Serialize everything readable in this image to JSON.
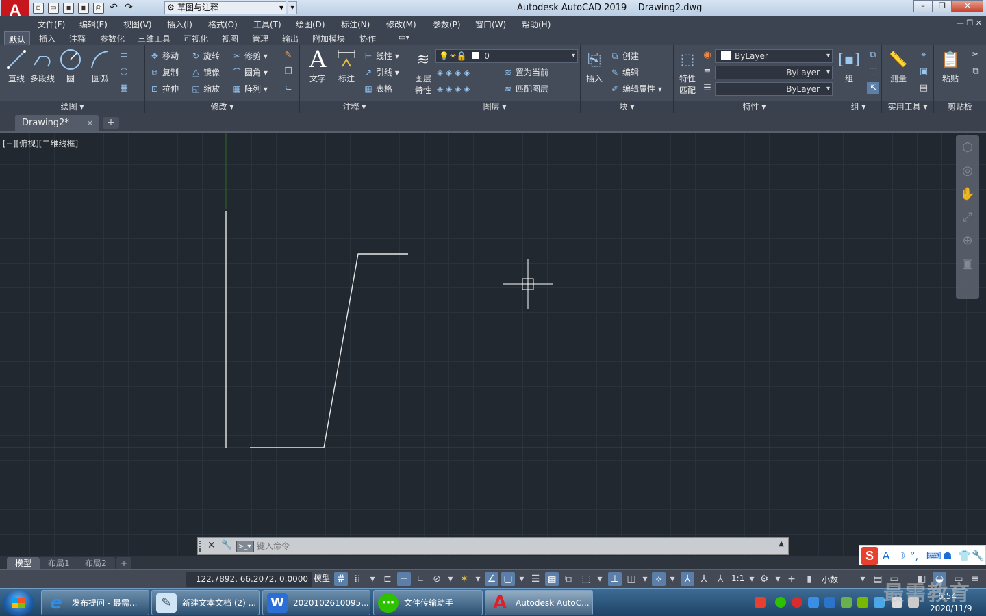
{
  "title_bar": {
    "logo_letter": "A",
    "workspace": "草图与注释",
    "app_title": "Autodesk AutoCAD 2019    Drawing2.dwg"
  },
  "menu": [
    "文件(F)",
    "编辑(E)",
    "视图(V)",
    "插入(I)",
    "格式(O)",
    "工具(T)",
    "绘图(D)",
    "标注(N)",
    "修改(M)",
    "参数(P)",
    "窗口(W)",
    "帮助(H)"
  ],
  "ribbon_tabs": [
    "默认",
    "插入",
    "注释",
    "参数化",
    "三维工具",
    "可视化",
    "视图",
    "管理",
    "输出",
    "附加模块",
    "协作"
  ],
  "ribbon": {
    "draw": {
      "title": "绘图",
      "line": "直线",
      "polyline": "多段线",
      "circle": "圆",
      "arc": "圆弧"
    },
    "modify": {
      "title": "修改",
      "move": "移动",
      "rotate": "旋转",
      "trim": "修剪",
      "copy": "复制",
      "mirror": "镜像",
      "fillet": "圆角",
      "stretch": "拉伸",
      "scale": "缩放",
      "array": "阵列"
    },
    "annotation": {
      "title": "注释",
      "text": "文字",
      "dimension": "标注",
      "linear": "线性",
      "leader": "引线",
      "table": "表格"
    },
    "layers": {
      "title": "图层",
      "layer_props": "图层特性",
      "layer_props_l1": "图层",
      "layer_props_l2": "特性",
      "current_layer": "0",
      "set_current": "置为当前",
      "match_layer": "匹配图层"
    },
    "block": {
      "title": "块",
      "insert": "插入",
      "create": "创建",
      "edit": "编辑",
      "edit_attr": "编辑属性"
    },
    "properties": {
      "title": "特性",
      "match_l1": "特性",
      "match_l2": "匹配",
      "color": "ByLayer",
      "linetype": "ByLayer",
      "lineweight": "ByLayer"
    },
    "groups": {
      "title": "组",
      "group": "组"
    },
    "utilities": {
      "title": "实用工具",
      "measure": "测量"
    },
    "clipboard": {
      "title": "剪贴板",
      "paste": "粘贴"
    }
  },
  "file_tab": {
    "name": "Drawing2*",
    "close": "×",
    "new": "+"
  },
  "viewport": {
    "label": "[−][俯视][二维线框]"
  },
  "command_line": {
    "placeholder": "键入命令"
  },
  "layout_tabs": [
    "模型",
    "布局1",
    "布局2"
  ],
  "layout_add": "+",
  "status_bar": {
    "coordinates": "122.7892, 66.2072, 0.0000",
    "space": "模型",
    "annotation_scale": "1:1",
    "units": "小数"
  },
  "taskbar": {
    "items": [
      "发布提问 - 最需...",
      "新建文本文档 (2) ...",
      "2020102610095...",
      "文件传输助手",
      "Autodesk AutoC..."
    ],
    "time": "6:54",
    "date": "2020/11/9"
  },
  "watermark": "最需教育",
  "colors": {
    "canvas_bg": "#212830",
    "grid": "#2a323c",
    "x_axis": "#7a2a2a",
    "y_axis": "#2a6a2a",
    "geometry": "#e8e8e8",
    "ribbon_bg": "#444c5a",
    "app_red": "#c5171d"
  }
}
